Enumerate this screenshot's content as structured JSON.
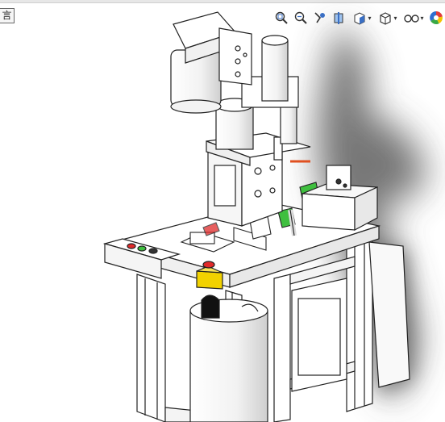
{
  "window": {
    "corner_button_glyph": "言"
  },
  "heads_up_toolbar": {
    "tools": [
      {
        "name": "zoom-to-fit",
        "icon": "zoom-fit-icon"
      },
      {
        "name": "zoom-to-area",
        "icon": "zoom-area-icon"
      },
      {
        "name": "previous-view",
        "icon": "previous-view-icon"
      },
      {
        "name": "section-view",
        "icon": "section-view-icon"
      },
      {
        "name": "view-orientation",
        "icon": "view-orientation-icon",
        "dropdown": true
      },
      {
        "name": "display-style",
        "icon": "display-style-icon",
        "dropdown": true
      },
      {
        "name": "hide-show-items",
        "icon": "hide-show-icon",
        "dropdown": true
      },
      {
        "name": "edit-appearance",
        "icon": "appearance-icon"
      }
    ],
    "caret_glyph": "▾"
  },
  "model": {
    "description_visible": false,
    "accent_colors": {
      "green_part": "#3fbf3f",
      "yellow_part": "#f2d200",
      "red_button": "#e02a2a",
      "shadow": "#3a3a3a"
    }
  }
}
